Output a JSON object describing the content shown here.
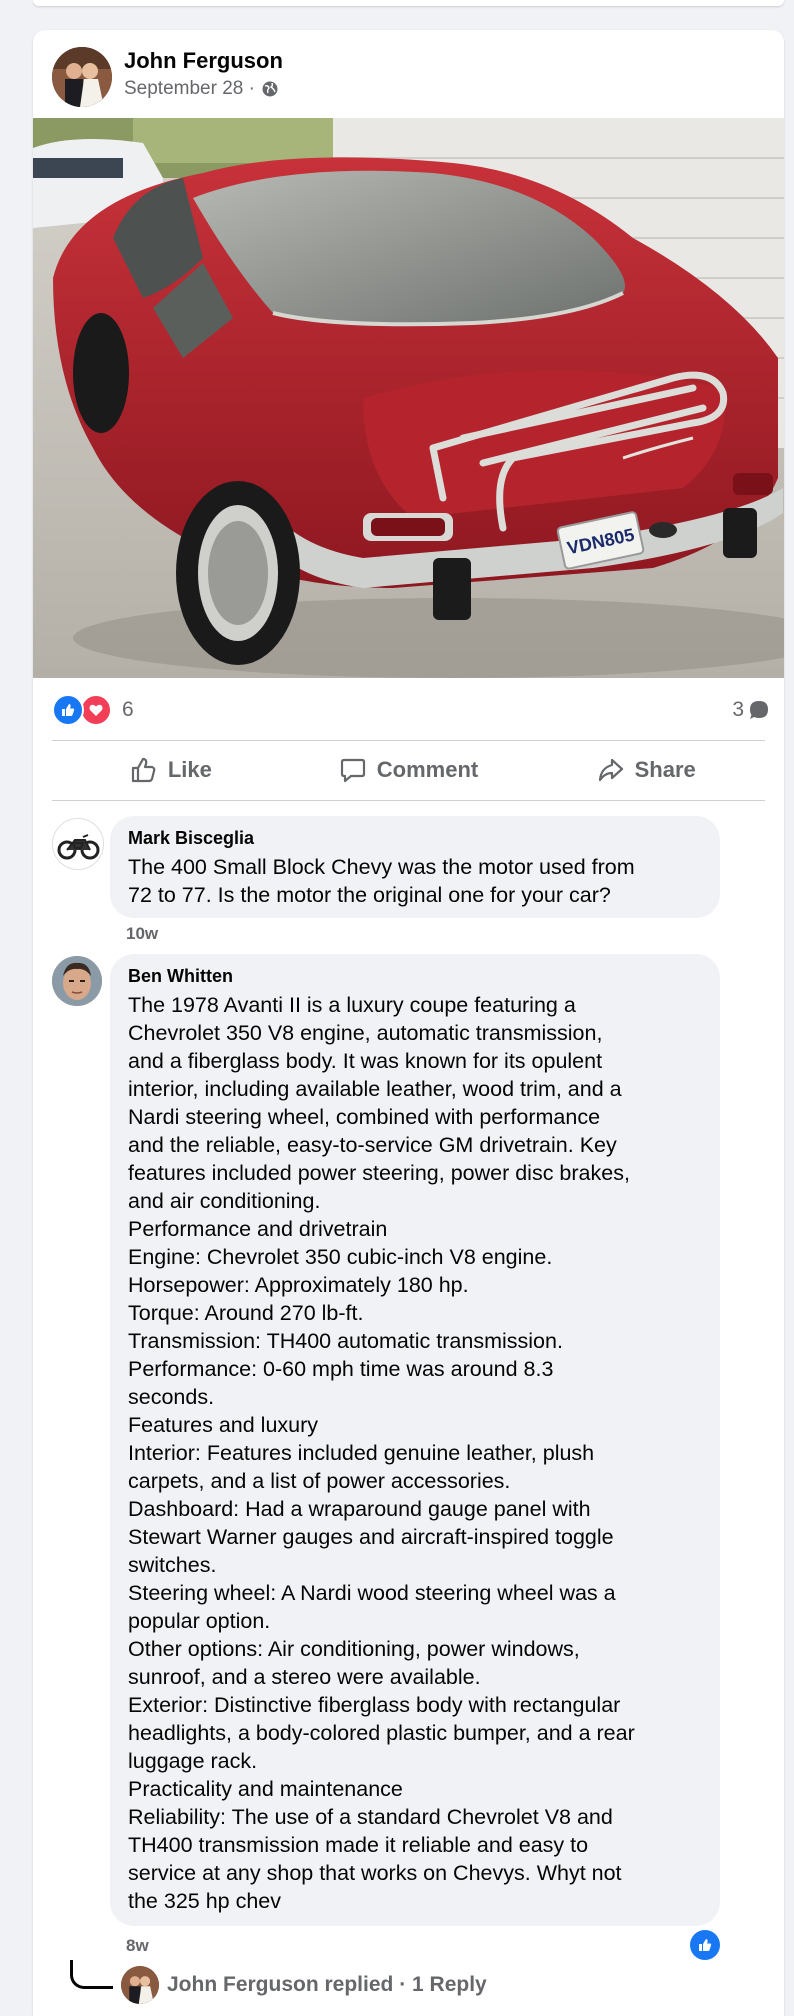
{
  "post": {
    "author": "John Ferguson",
    "date": "September 28 ·",
    "visibility_icon": "globe-icon"
  },
  "photo": {
    "plate_text": "VDN805"
  },
  "reactions": {
    "count": "6",
    "types": [
      "like-icon",
      "love-icon"
    ],
    "comment_count": "3"
  },
  "actions": {
    "like": "Like",
    "comment": "Comment",
    "share": "Share"
  },
  "comments": [
    {
      "name": "Mark Bisceglia",
      "text": "The 400 Small Block Chevy was the motor used from\n72 to 77. Is the motor the original one for your car?",
      "time": "10w"
    },
    {
      "name": "Ben Whitten",
      "text": "The 1978 Avanti II is a luxury coupe featuring a\nChevrolet 350 V8 engine, automatic transmission,\nand a fiberglass body. It was known for its opulent\ninterior, including available leather, wood trim, and a\nNardi steering wheel, combined with performance\nand the reliable, easy-to-service GM drivetrain. Key\nfeatures included power steering, power disc brakes,\nand air conditioning.\nPerformance and drivetrain\nEngine: Chevrolet 350 cubic-inch V8 engine.\nHorsepower: Approximately 180 hp.\nTorque: Around 270 lb-ft.\nTransmission: TH400 automatic transmission.\nPerformance: 0-60 mph time was around 8.3\nseconds.\nFeatures and luxury\nInterior: Features included genuine leather, plush\ncarpets, and a list of power accessories.\nDashboard: Had a wraparound gauge panel with\nStewart Warner gauges and aircraft-inspired toggle\nswitches.\nSteering wheel: A Nardi wood steering wheel was a\npopular option.\nOther options: Air conditioning, power windows,\nsunroof, and a stereo were available.\nExterior: Distinctive fiberglass body with rectangular\nheadlights, a body-colored plastic bumper, and a rear\nluggage rack.\nPracticality and maintenance\nReliability: The use of a standard Chevrolet V8 and\nTH400 transmission made it reliable and easy to\nservice at any shop that works on Chevys. Whyt not\nthe 325 hp chev",
      "time": "8w"
    }
  ],
  "reply_summary": "John Ferguson replied · 1 Reply",
  "colors": {
    "accent": "#1877f2",
    "love": "#f33e58",
    "car_red": "#b3202a",
    "muted_text": "#65676b"
  }
}
